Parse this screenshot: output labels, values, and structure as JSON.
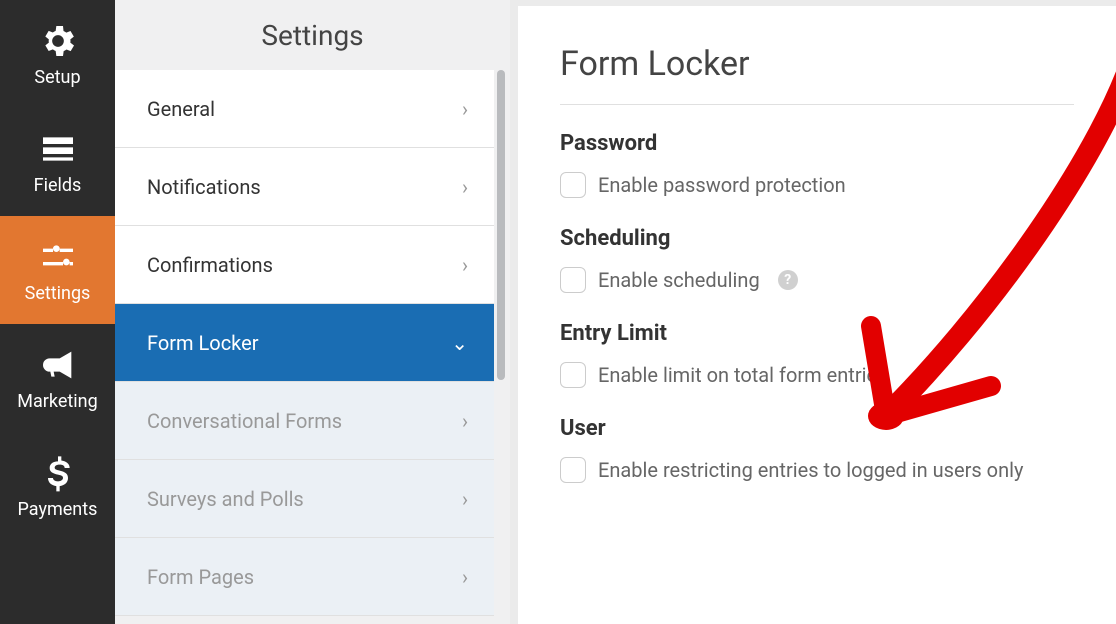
{
  "header": {
    "title": "Settings"
  },
  "leftbar": {
    "items": [
      {
        "label": "Setup",
        "icon": "gear-icon"
      },
      {
        "label": "Fields",
        "icon": "list-icon"
      },
      {
        "label": "Settings",
        "icon": "sliders-icon"
      },
      {
        "label": "Marketing",
        "icon": "bullhorn-icon"
      },
      {
        "label": "Payments",
        "icon": "dollar-icon"
      }
    ],
    "active_index": 2
  },
  "settings_menu": {
    "items": [
      {
        "label": "General",
        "state": "normal"
      },
      {
        "label": "Notifications",
        "state": "normal"
      },
      {
        "label": "Confirmations",
        "state": "normal"
      },
      {
        "label": "Form Locker",
        "state": "selected"
      },
      {
        "label": "Conversational Forms",
        "state": "dim"
      },
      {
        "label": "Surveys and Polls",
        "state": "dim"
      },
      {
        "label": "Form Pages",
        "state": "dim"
      }
    ]
  },
  "panel": {
    "title": "Form Locker",
    "sections": [
      {
        "heading": "Password",
        "checkbox_label": "Enable password protection",
        "help": false
      },
      {
        "heading": "Scheduling",
        "checkbox_label": "Enable scheduling",
        "help": true
      },
      {
        "heading": "Entry Limit",
        "checkbox_label": "Enable limit on total form entries",
        "help": false
      },
      {
        "heading": "User",
        "checkbox_label": "Enable restricting entries to logged in users only",
        "help": false
      }
    ]
  },
  "annotation": {
    "color": "#e20000"
  }
}
